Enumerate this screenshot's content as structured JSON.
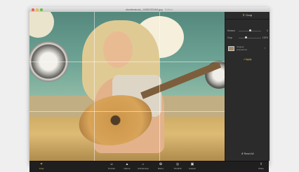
{
  "window": {
    "title": "shutterstock_1455133184.jpg",
    "subtitle": "Edited"
  },
  "sidebar": {
    "header": {
      "icon": "crop-icon",
      "label": "Crop"
    },
    "sliders": [
      {
        "label": "Horizon",
        "value": "0",
        "level": 0.5
      },
      {
        "label": "Crop",
        "value": "132%",
        "level": 0.3
      }
    ],
    "orientation": {
      "label": "Original\nproportions"
    },
    "apply_label": "Apply",
    "reset_label": "Reset All"
  },
  "toolbar": {
    "items": [
      {
        "label": "Crop",
        "icon": "crop-icon",
        "active": true
      },
      {
        "label": "Portrait",
        "icon": "portrait-icon"
      },
      {
        "label": "Nature",
        "icon": "nature-icon"
      },
      {
        "label": "Architecture",
        "icon": "architecture-icon"
      },
      {
        "label": "Macro",
        "icon": "macro-icon"
      },
      {
        "label": "Tilt-Shift",
        "icon": "tilt-shift-icon"
      },
      {
        "label": "Custom",
        "icon": "custom-icon"
      },
      {
        "label": "Share",
        "icon": "share-icon"
      }
    ]
  },
  "colors": {
    "accent": "#e7c54a",
    "panel": "#2b2b2b",
    "toolbar": "#1f1f1f"
  }
}
